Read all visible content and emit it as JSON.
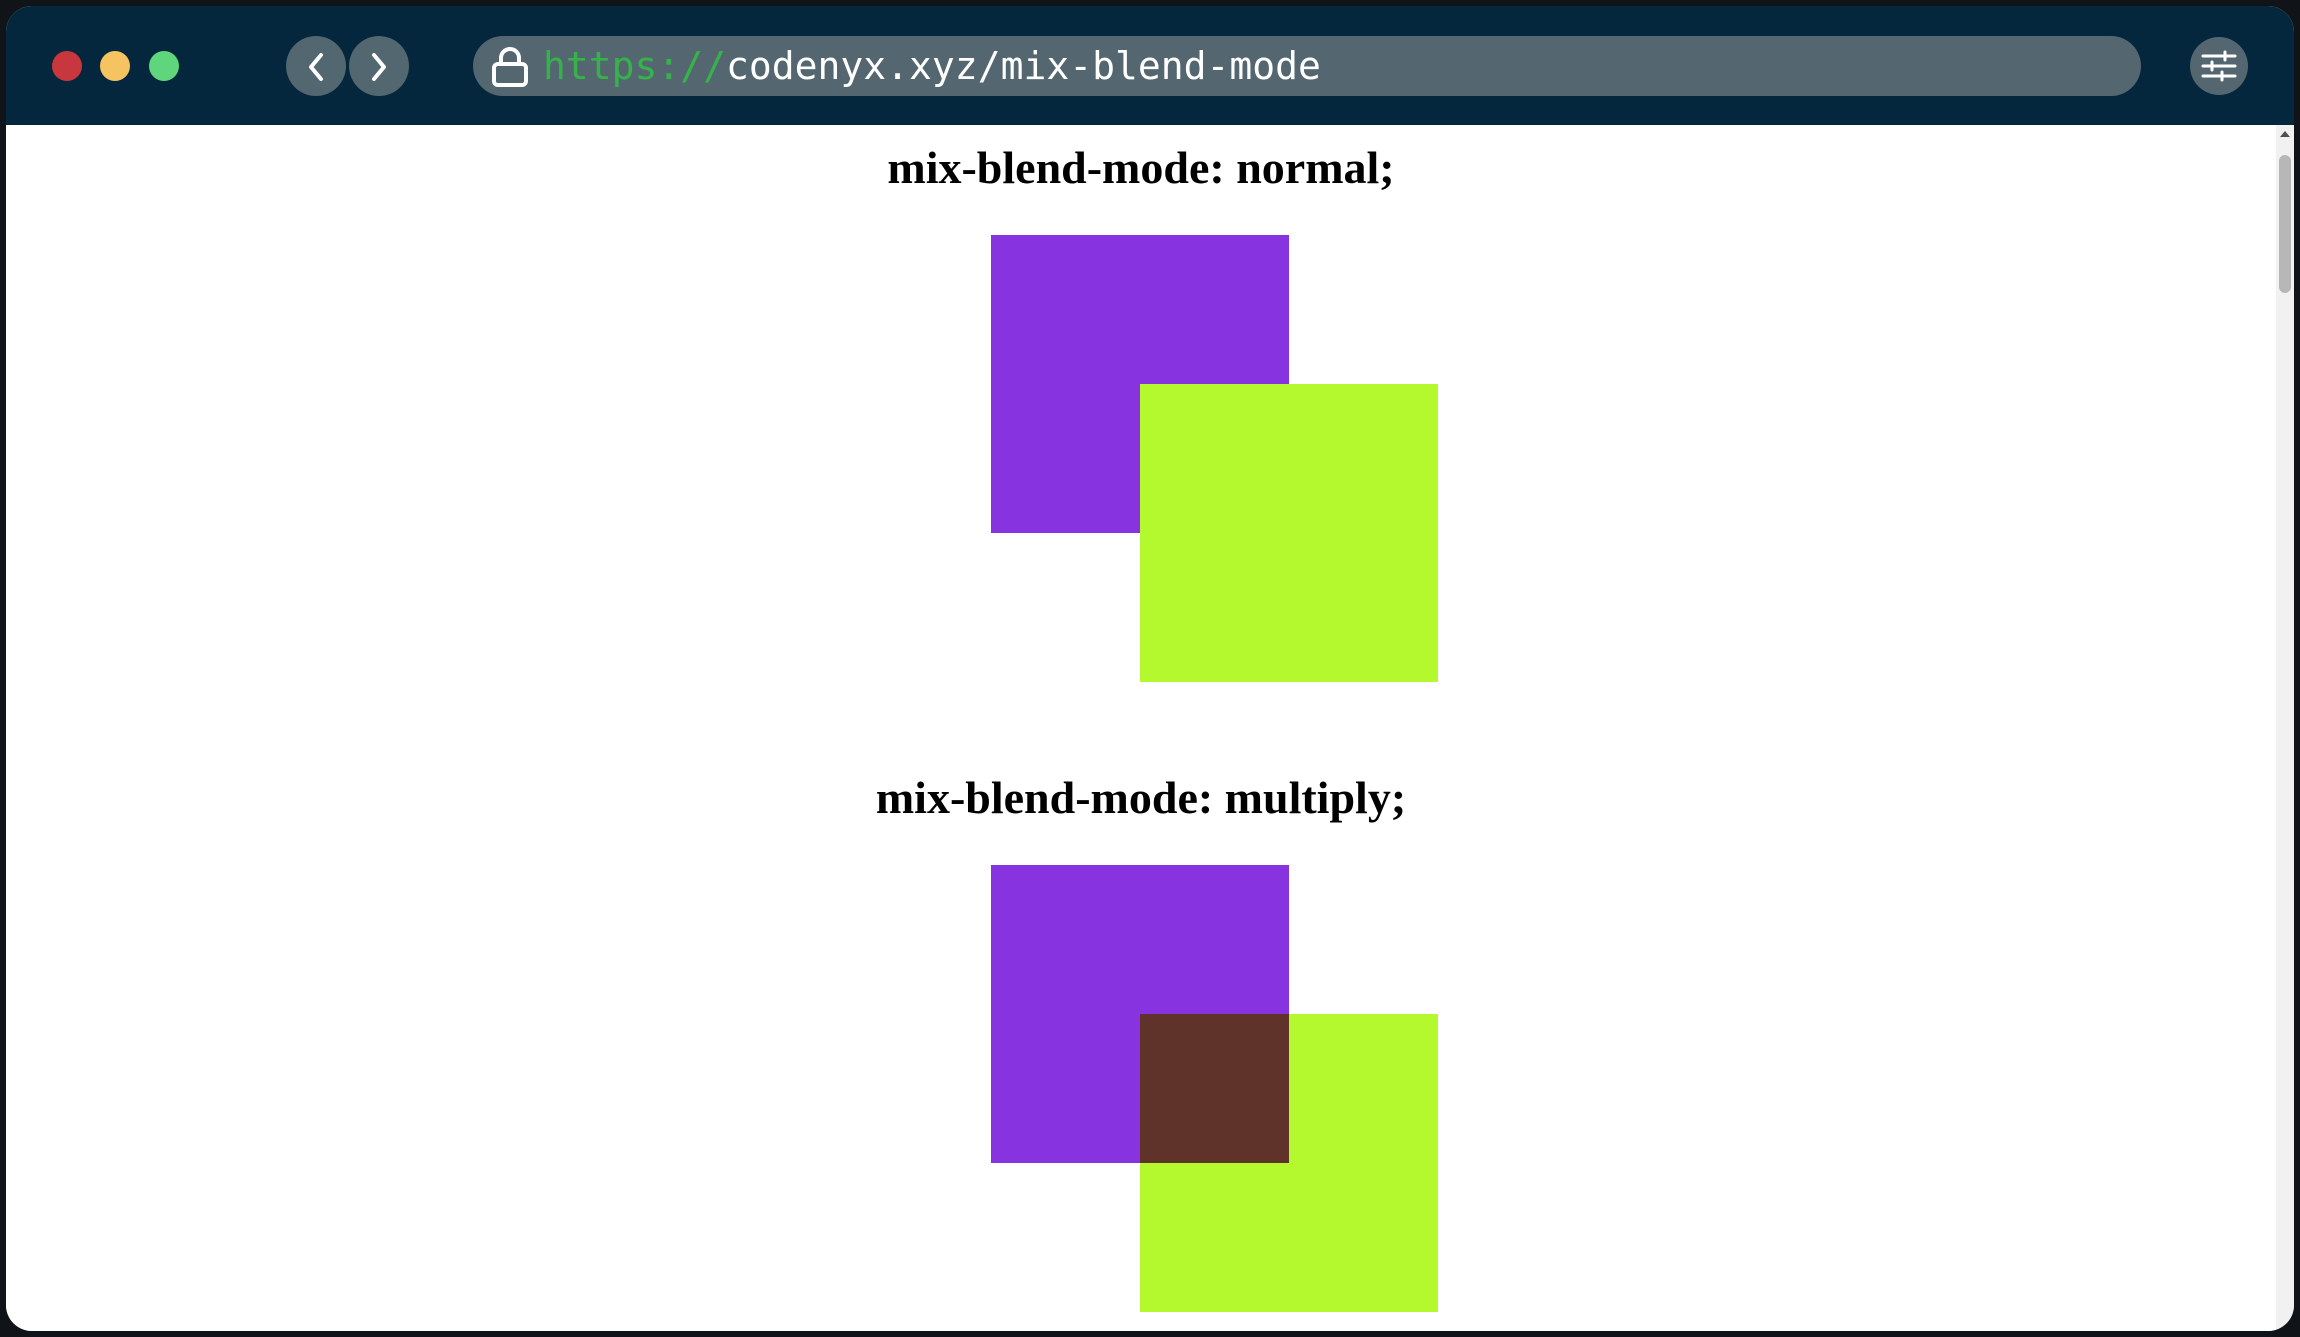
{
  "browser": {
    "url_protocol": "https://",
    "url_path": "codenyx.xyz/mix-blend-mode",
    "icons": {
      "close": "close-light",
      "minimize": "minimize-light",
      "maximize": "maximize-light",
      "back": "chevron-left-icon",
      "forward": "chevron-right-icon",
      "lock": "lock-icon",
      "settings": "sliders-icon"
    }
  },
  "colors": {
    "titlebar": "#04273d",
    "purple": "#8734e0",
    "lime": "#b3f92e",
    "url_protocol": "#35b34a"
  },
  "demos": [
    {
      "title": "mix-blend-mode: normal;",
      "blend": "normal"
    },
    {
      "title": "mix-blend-mode: multiply;",
      "blend": "multiply"
    }
  ]
}
